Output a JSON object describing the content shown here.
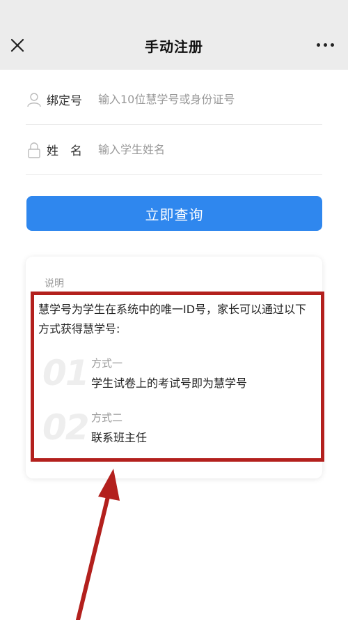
{
  "header": {
    "title": "手动注册",
    "close_icon": "close-icon",
    "more_icon": "more-dots-icon"
  },
  "form": {
    "bind_label": "绑定号",
    "bind_placeholder": "输入10位慧学号或身份证号",
    "name_label": "姓　名",
    "name_placeholder": "输入学生姓名"
  },
  "query_button": "立即查询",
  "explanation": {
    "title": "说明",
    "description": "慧学号为学生在系统中的唯一ID号，家长可以通过以下方式获得慧学号:",
    "methods": [
      {
        "num": "01",
        "name": "方式一",
        "text": "学生试卷上的考试号即为慧学号"
      },
      {
        "num": "02",
        "name": "方式二",
        "text": "联系班主任"
      }
    ]
  },
  "colors": {
    "accent": "#2f87ee",
    "annotation": "#b3201d",
    "header_bg": "#ececec"
  }
}
